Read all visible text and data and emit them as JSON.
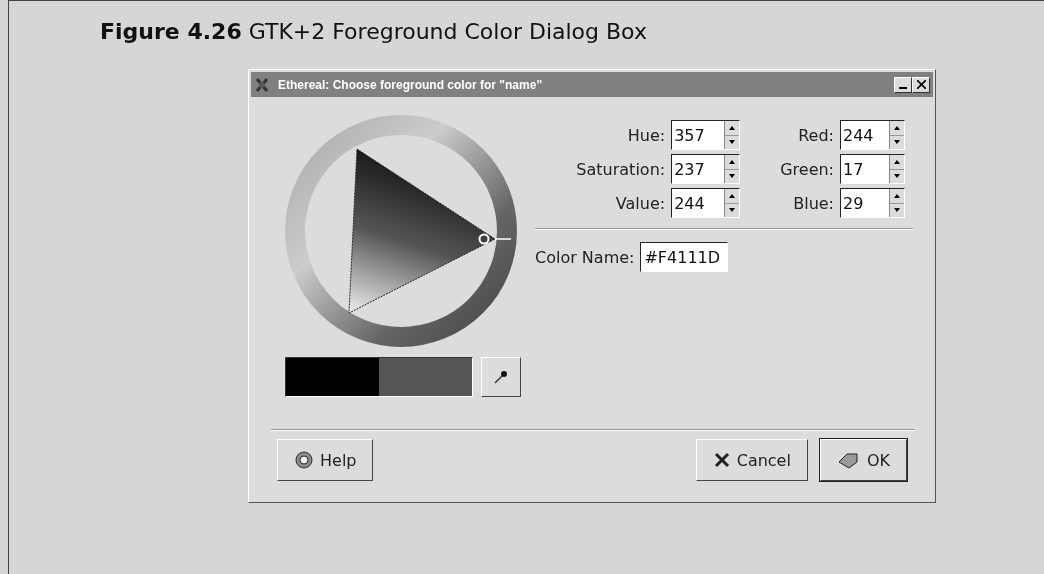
{
  "caption": "**Figure 4.26** GTK+2 Foreground Color Dialog Box",
  "window": {
    "title": "Ethereal: Choose foreground color for \"name\""
  },
  "swatches": [
    {
      "color": "#000000"
    },
    {
      "color": "#555555"
    }
  ],
  "spinners": [
    [
      {
        "label": "Hue:",
        "value": "357"
      },
      {
        "label": "Red:",
        "value": "244"
      }
    ],
    [
      {
        "label": "Saturation:",
        "value": "237"
      },
      {
        "label": "Green:",
        "value": "17"
      }
    ],
    [
      {
        "label": "Value:",
        "value": "244"
      },
      {
        "label": "Blue:",
        "value": "29"
      }
    ]
  ],
  "color_name": {
    "label": "Color Name:",
    "value": "#F4111D"
  },
  "buttons": [
    {
      "kind": "help",
      "label": "Help",
      "selected": false
    },
    {
      "kind": "cancel",
      "label": "Cancel",
      "selected": false
    },
    {
      "kind": "ok",
      "label": "OK",
      "selected": true
    }
  ]
}
